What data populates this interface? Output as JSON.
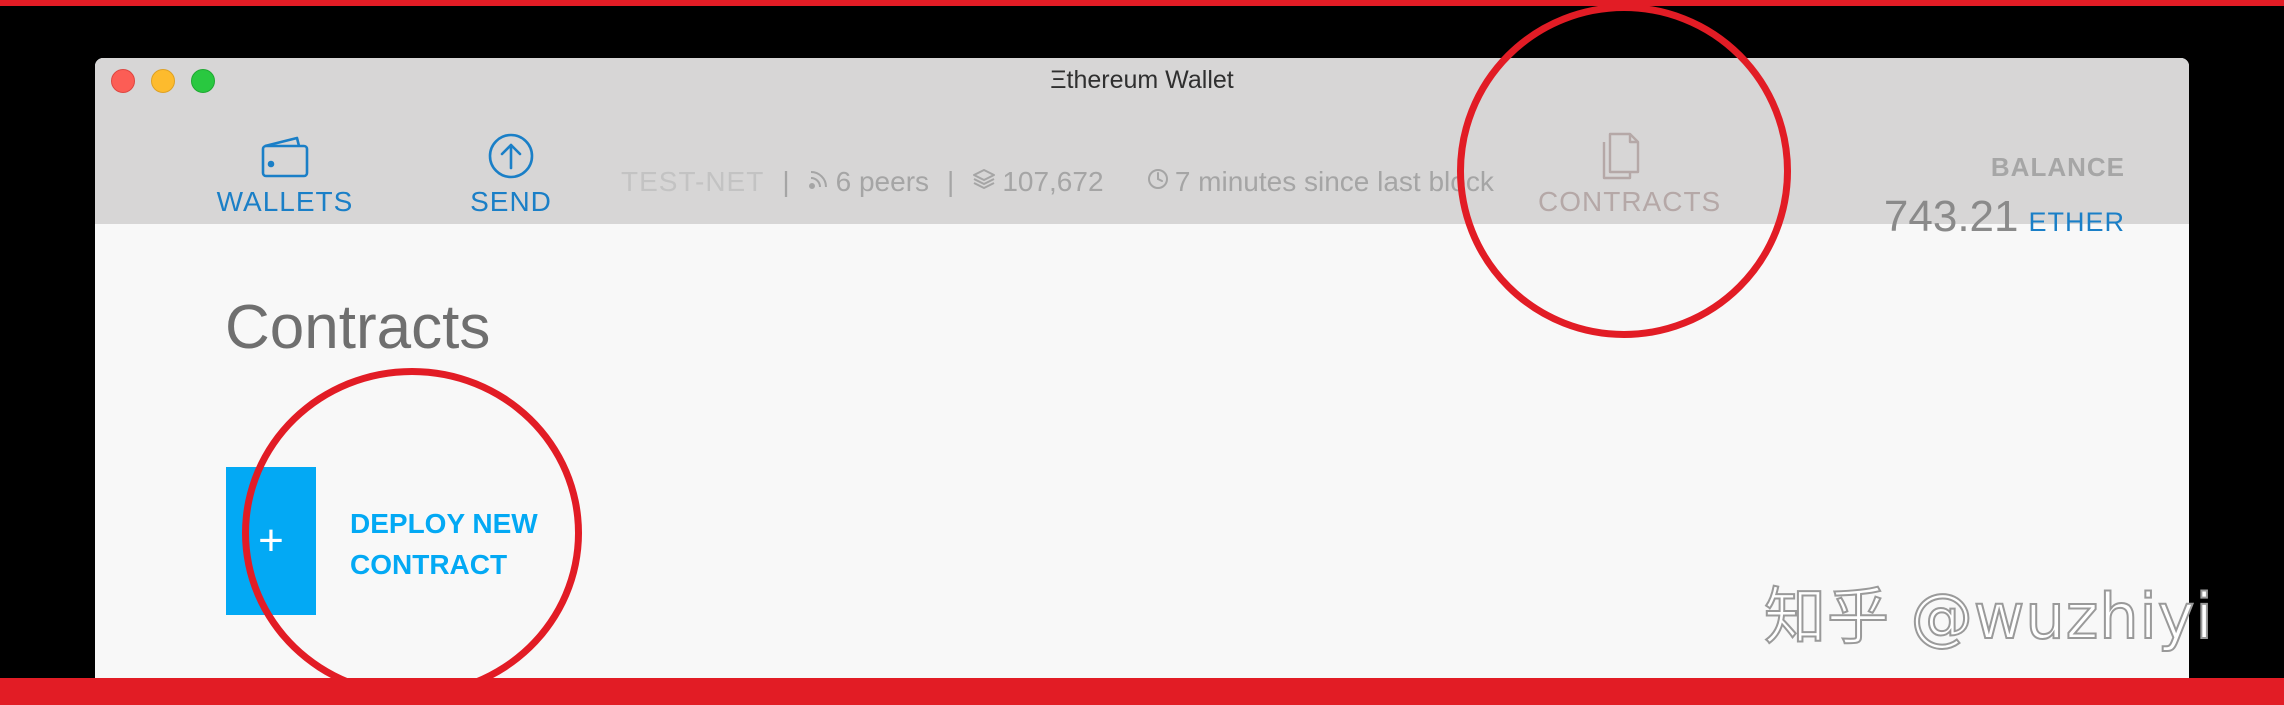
{
  "window": {
    "title": "Ξthereum Wallet"
  },
  "nav": {
    "wallets": {
      "label": "WALLETS",
      "icon": "wallet-icon"
    },
    "send": {
      "label": "SEND",
      "icon": "arrow-up-circle-icon"
    },
    "contracts": {
      "label": "CONTRACTS",
      "icon": "documents-icon"
    }
  },
  "status": {
    "network": "TEST-NET",
    "separator": "|",
    "peers": "6 peers",
    "block_number": "107,672",
    "last_block": "7 minutes since last block"
  },
  "balance": {
    "label": "BALANCE",
    "amount": "743.21",
    "unit": "ETHER"
  },
  "main": {
    "title": "Contracts",
    "deploy_button": {
      "plus": "+",
      "label": "DEPLOY NEW CONTRACT"
    }
  },
  "watermark": "知乎 @wuzhiyi",
  "colors": {
    "accent": "#1a7fc7",
    "deploy_blue": "#03a9f4",
    "annotation_red": "#e21c25",
    "header_bg": "#d7d6d6",
    "contracts_inactive": "#b5a8a7"
  }
}
